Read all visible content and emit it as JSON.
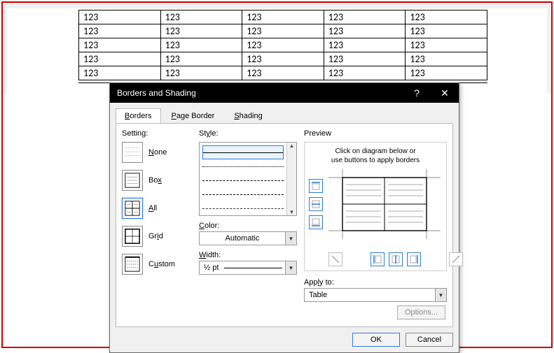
{
  "doc_table": {
    "rows": [
      [
        "123",
        "123",
        "123",
        "123",
        "123"
      ],
      [
        "123",
        "123",
        "123",
        "123",
        "123"
      ],
      [
        "123",
        "123",
        "123",
        "123",
        "123"
      ],
      [
        "123",
        "123",
        "123",
        "123",
        "123"
      ],
      [
        "123",
        "123",
        "123",
        "123",
        "123"
      ]
    ]
  },
  "dialog": {
    "title": "Borders and Shading",
    "help_icon": "?",
    "close_icon": "✕",
    "tabs": [
      {
        "u": "B",
        "rest": "orders"
      },
      {
        "u": "P",
        "rest": "age Border"
      },
      {
        "u": "S",
        "rest": "hading"
      }
    ],
    "setting_label": "Setting:",
    "settings": [
      {
        "u": "N",
        "rest": "one"
      },
      {
        "pre": "Bo",
        "u": "x",
        "rest": ""
      },
      {
        "u": "A",
        "rest": "ll"
      },
      {
        "pre": "Gr",
        "u": "i",
        "rest": "d"
      },
      {
        "pre": "C",
        "u": "u",
        "rest": "stom"
      }
    ],
    "style_label_pre": "St",
    "style_label_u": "y",
    "style_label_rest": "le:",
    "color_label_u": "C",
    "color_label_rest": "olor:",
    "color_value": "Automatic",
    "width_label_u": "W",
    "width_label_rest": "idth:",
    "width_value": "½ pt",
    "preview_label": "Preview",
    "preview_hint_1": "Click on diagram below or",
    "preview_hint_2": "use buttons to apply borders",
    "apply_to_label_pre": "App",
    "apply_to_label_u": "l",
    "apply_to_label_rest": "y to:",
    "apply_to_value": "Table",
    "options_label": "Options...",
    "ok_label": "OK",
    "cancel_label": "Cancel"
  }
}
